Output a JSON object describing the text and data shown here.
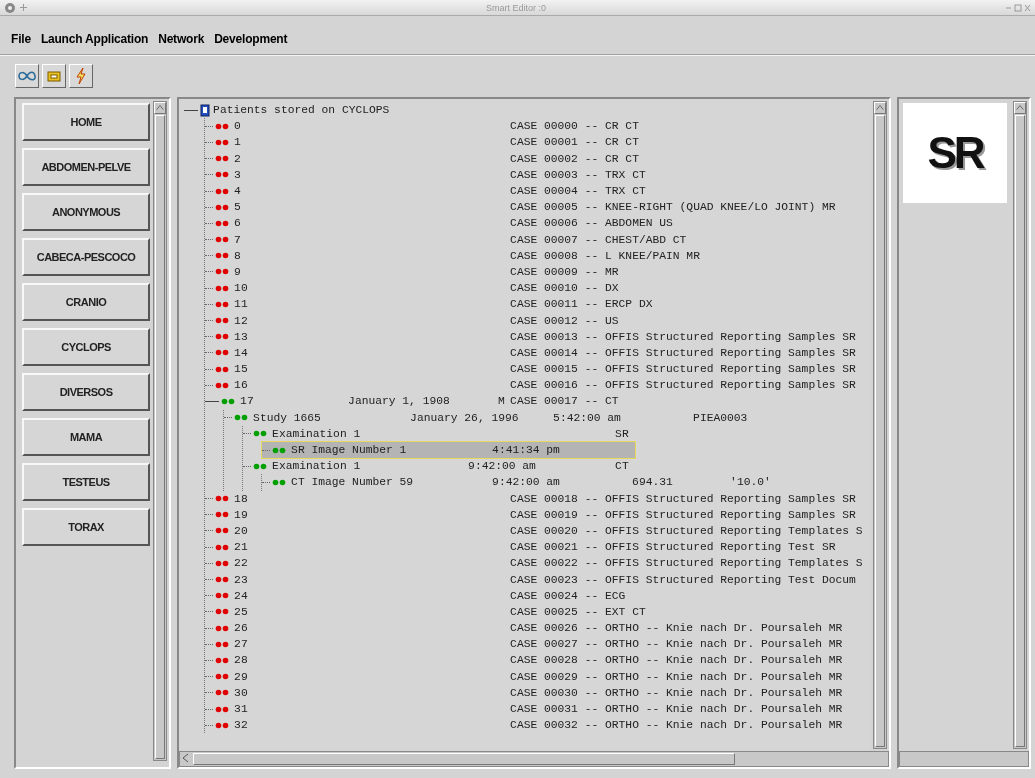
{
  "window": {
    "title": "Smart Editor :0"
  },
  "menu": [
    "File",
    "Launch Application",
    "Network",
    "Development"
  ],
  "sidebar": {
    "items": [
      "HOME",
      "ABDOMEN-PELVE",
      "ANONYMOUS",
      "CABECA-PESCOCO",
      "CRANIO",
      "CYCLOPS",
      "DIVERSOS",
      "MAMA",
      "TESTEUS",
      "TORAX"
    ]
  },
  "tree": {
    "root": "Patients stored on CYCLOPS",
    "items": [
      {
        "kind": "patient",
        "label": "0",
        "case": "CASE 00000 -- CR CT",
        "color": "#e00000",
        "expanded": false
      },
      {
        "kind": "patient",
        "label": "1",
        "case": "CASE 00001 -- CR CT",
        "color": "#e00000",
        "expanded": false
      },
      {
        "kind": "patient",
        "label": "2",
        "case": "CASE 00002 -- CR CT",
        "color": "#e00000",
        "expanded": false
      },
      {
        "kind": "patient",
        "label": "3",
        "case": "CASE 00003 -- TRX CT",
        "color": "#e00000",
        "expanded": false
      },
      {
        "kind": "patient",
        "label": "4",
        "case": "CASE 00004 -- TRX CT",
        "color": "#e00000",
        "expanded": false
      },
      {
        "kind": "patient",
        "label": "5",
        "case": "CASE 00005 -- KNEE-RIGHT (QUAD KNEE/LO JOINT) MR",
        "color": "#e00000",
        "expanded": false
      },
      {
        "kind": "patient",
        "label": "6",
        "case": "CASE 00006 -- ABDOMEN US",
        "color": "#e00000",
        "expanded": false
      },
      {
        "kind": "patient",
        "label": "7",
        "case": "CASE 00007 -- CHEST/ABD CT",
        "color": "#e00000",
        "expanded": false
      },
      {
        "kind": "patient",
        "label": "8",
        "case": "CASE 00008 -- L KNEE/PAIN MR",
        "color": "#e00000",
        "expanded": false
      },
      {
        "kind": "patient",
        "label": "9",
        "case": "CASE 00009 -- MR",
        "color": "#e00000",
        "expanded": false
      },
      {
        "kind": "patient",
        "label": "10",
        "case": "CASE 00010 -- DX",
        "color": "#e00000",
        "expanded": false
      },
      {
        "kind": "patient",
        "label": "11",
        "case": "CASE 00011 -- ERCP DX",
        "color": "#e00000",
        "expanded": false
      },
      {
        "kind": "patient",
        "label": "12",
        "case": "CASE 00012 -- US",
        "color": "#e00000",
        "expanded": false
      },
      {
        "kind": "patient",
        "label": "13",
        "case": "CASE 00013 -- OFFIS Structured Reporting Samples SR",
        "color": "#e00000",
        "expanded": false
      },
      {
        "kind": "patient",
        "label": "14",
        "case": "CASE 00014 -- OFFIS Structured Reporting Samples SR",
        "color": "#e00000",
        "expanded": false
      },
      {
        "kind": "patient",
        "label": "15",
        "case": "CASE 00015 -- OFFIS Structured Reporting Samples SR",
        "color": "#e00000",
        "expanded": false
      },
      {
        "kind": "patient",
        "label": "16",
        "case": "CASE 00016 -- OFFIS Structured Reporting Samples SR",
        "color": "#e00000",
        "expanded": false
      },
      {
        "kind": "patient",
        "label": "17",
        "date": "January 1, 1908",
        "sex": "M",
        "case": "CASE 00017 -- CT",
        "color": "#00a000",
        "expanded": true,
        "children": [
          {
            "kind": "study",
            "label": "Study 1665",
            "date": "January 26, 1996",
            "time": "5:42:00 am",
            "id": "PIEA0003",
            "color": "#00a000",
            "children": [
              {
                "kind": "examination",
                "label": "Examination 1",
                "modality": "SR",
                "color": "#00a000",
                "children": [
                  {
                    "kind": "image",
                    "label": "SR Image Number 1",
                    "time": "4:41:34 pm",
                    "color": "#00a000",
                    "selected": true
                  }
                ]
              },
              {
                "kind": "examination",
                "label": "Examination 1",
                "time": "9:42:00 am",
                "modality": "CT",
                "color": "#00a000",
                "children": [
                  {
                    "kind": "image",
                    "label": "CT Image Number 59",
                    "time": "9:42:00 am",
                    "value": "694.31",
                    "extra": "'10.0'",
                    "color": "#00a000",
                    "selected": false
                  }
                ]
              }
            ]
          }
        ]
      },
      {
        "kind": "patient",
        "label": "18",
        "case": "CASE 00018 -- OFFIS Structured Reporting Samples SR",
        "color": "#e00000",
        "expanded": false
      },
      {
        "kind": "patient",
        "label": "19",
        "case": "CASE 00019 -- OFFIS Structured Reporting Samples SR",
        "color": "#e00000",
        "expanded": false
      },
      {
        "kind": "patient",
        "label": "20",
        "case": "CASE 00020 -- OFFIS Structured Reporting Templates S",
        "color": "#e00000",
        "expanded": false
      },
      {
        "kind": "patient",
        "label": "21",
        "case": "CASE 00021 -- OFFIS Structured Reporting Test SR",
        "color": "#e00000",
        "expanded": false
      },
      {
        "kind": "patient",
        "label": "22",
        "case": "CASE 00022 -- OFFIS Structured Reporting Templates S",
        "color": "#e00000",
        "expanded": false
      },
      {
        "kind": "patient",
        "label": "23",
        "case": "CASE 00023 -- OFFIS Structured Reporting Test Docum",
        "color": "#e00000",
        "expanded": false
      },
      {
        "kind": "patient",
        "label": "24",
        "case": "CASE 00024 -- ECG",
        "color": "#e00000",
        "expanded": false
      },
      {
        "kind": "patient",
        "label": "25",
        "case": "CASE 00025 -- EXT CT",
        "color": "#e00000",
        "expanded": false
      },
      {
        "kind": "patient",
        "label": "26",
        "case": "CASE 00026 -- ORTHO -- Knie nach Dr. Poursaleh MR",
        "color": "#e00000",
        "expanded": false
      },
      {
        "kind": "patient",
        "label": "27",
        "case": "CASE 00027 -- ORTHO -- Knie nach Dr. Poursaleh MR",
        "color": "#e00000",
        "expanded": false
      },
      {
        "kind": "patient",
        "label": "28",
        "case": "CASE 00028 -- ORTHO -- Knie nach Dr. Poursaleh MR",
        "color": "#e00000",
        "expanded": false
      },
      {
        "kind": "patient",
        "label": "29",
        "case": "CASE 00029 -- ORTHO -- Knie nach Dr. Poursaleh MR",
        "color": "#e00000",
        "expanded": false
      },
      {
        "kind": "patient",
        "label": "30",
        "case": "CASE 00030 -- ORTHO -- Knie nach Dr. Poursaleh MR",
        "color": "#e00000",
        "expanded": false
      },
      {
        "kind": "patient",
        "label": "31",
        "case": "CASE 00031 -- ORTHO -- Knie nach Dr. Poursaleh MR",
        "color": "#e00000",
        "expanded": false
      },
      {
        "kind": "patient",
        "label": "32",
        "case": "CASE 00032 -- ORTHO -- Knie nach Dr. Poursaleh MR",
        "color": "#e00000",
        "expanded": false
      }
    ]
  },
  "preview": {
    "logo_text": "SR"
  }
}
